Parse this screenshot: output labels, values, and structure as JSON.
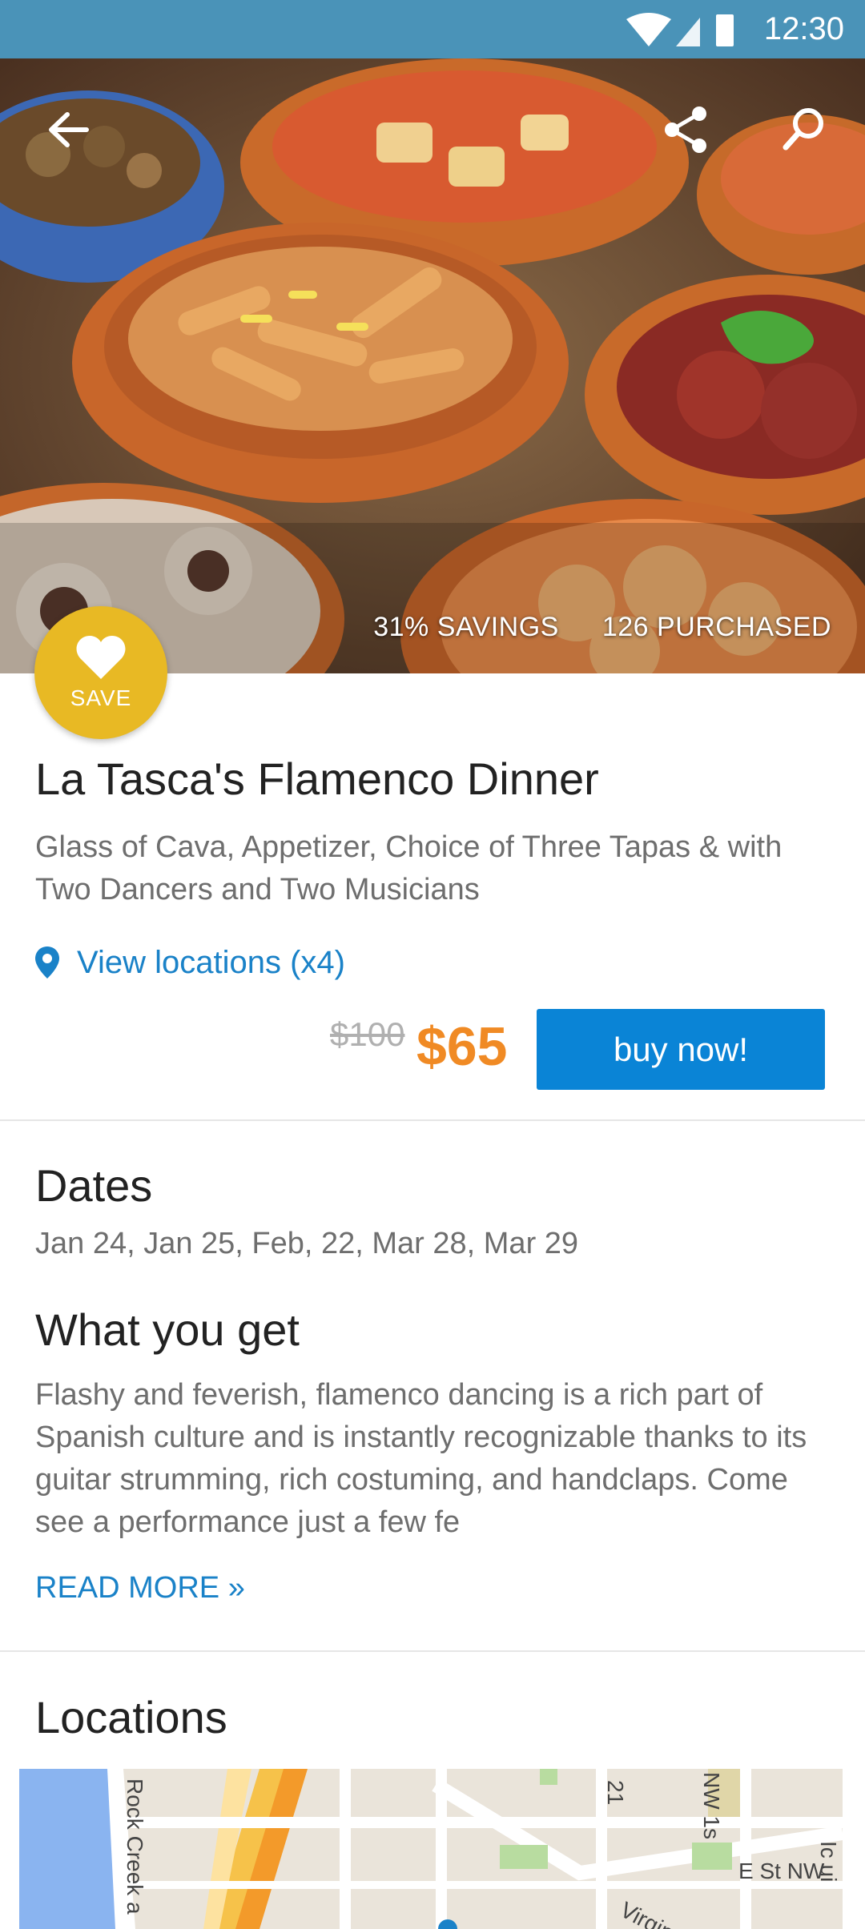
{
  "status_bar": {
    "time": "12:30"
  },
  "hero": {
    "savings": "31% SAVINGS",
    "purchased": "126 PURCHASED"
  },
  "save_button": {
    "label": "SAVE"
  },
  "deal": {
    "title": "La Tasca's Flamenco Dinner",
    "subtitle": "Glass of Cava, Appetizer, Choice of Three Tapas & with Two Dancers and Two Musicians",
    "locations_link": "View locations (x4)",
    "original_price": "$100",
    "price": "$65",
    "buy_label": "buy now!"
  },
  "dates": {
    "heading": "Dates",
    "list": "Jan 24, Jan 25, Feb, 22, Mar 28, Mar 29"
  },
  "what_you_get": {
    "heading": "What you get",
    "description": "Flashy and feverish, flamenco dancing is a rich part of Spanish culture and is instantly recognizable thanks to its guitar strumming, rich costuming, and handclaps. Come see a performance just a few fe",
    "read_more": "READ MORE »"
  },
  "locations": {
    "heading": "Locations",
    "map_labels": {
      "rock_creek": "Rock Creek a",
      "street_21": "21",
      "nw": "NW 1s",
      "e_st": "E St NW",
      "virginia": "Virgin",
      "edge": "Ic ui"
    }
  },
  "colors": {
    "status_bar": "#4a93b8",
    "accent_blue": "#0a84d6",
    "price_orange": "#f08a24",
    "save_yellow": "#e8b924"
  }
}
